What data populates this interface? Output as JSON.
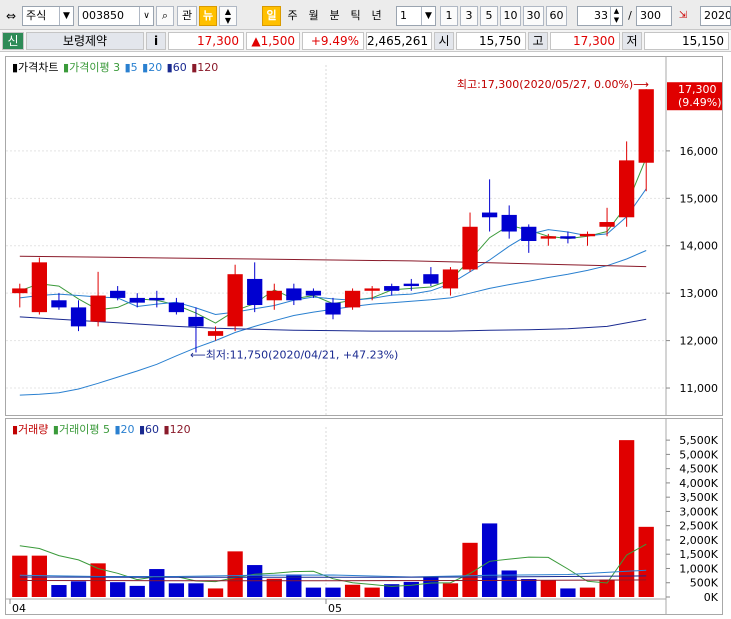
{
  "toolbar": {
    "market_select": "주식",
    "code_input": "003850",
    "btn_gwan": "관",
    "btn_news": "뉴",
    "period_tabs": [
      "일",
      "주",
      "월",
      "분",
      "틱",
      "년"
    ],
    "active_period": "일",
    "interval_value": "1",
    "interval_buttons": [
      "1",
      "3",
      "5",
      "10",
      "30",
      "60"
    ],
    "range_start": "33",
    "range_slash": "/",
    "range_total": "300",
    "date_field": "2020/"
  },
  "quote": {
    "tag": "신",
    "name": "보령제약",
    "info_btn": "i",
    "price": "17,300",
    "change": "▲1,500",
    "change_pct": "+9.49%",
    "volume": "2,465,261",
    "open_label": "시",
    "open": "15,750",
    "high_label": "고",
    "high": "17,300",
    "low_label": "저",
    "low": "15,150"
  },
  "price_panel": {
    "legend": [
      {
        "text": "가격차트",
        "color": "#000000"
      },
      {
        "text": "가격이평 3",
        "color": "#3a9a3a"
      },
      {
        "text": "5",
        "color": "#2a80d0"
      },
      {
        "text": "20",
        "color": "#2a80d0"
      },
      {
        "text": "60",
        "color": "#1a2a90"
      },
      {
        "text": "120",
        "color": "#8a1a2a"
      }
    ],
    "high_annotation": "최고:17,300(2020/05/27, 0.00%)⟶",
    "low_annotation": "⟵최저:11,750(2020/04/21, +47.23%)",
    "last_price_label": "17,300",
    "last_pct_label": "(9.49%)",
    "y_ticks": [
      "16,000",
      "15,000",
      "14,000",
      "13,000",
      "12,000",
      "11,000"
    ],
    "colors": {
      "up": "#e00000",
      "down": "#0000d0"
    }
  },
  "volume_panel": {
    "legend": [
      {
        "text": "거래량",
        "color": "#c00000"
      },
      {
        "text": "거래이평 5",
        "color": "#3a9a3a"
      },
      {
        "text": "20",
        "color": "#2a80d0"
      },
      {
        "text": "60",
        "color": "#1a2a90"
      },
      {
        "text": "120",
        "color": "#8a1a2a"
      }
    ],
    "y_ticks": [
      "5,500K",
      "5,000K",
      "4,500K",
      "4,000K",
      "3,500K",
      "3,000K",
      "2,500K",
      "2,000K",
      "1,500K",
      "1,000K",
      "500K",
      "0K"
    ],
    "x_ticks": [
      "04",
      "05"
    ]
  },
  "chart_data": {
    "type": "candlestick",
    "price_ylim": [
      10600,
      17600
    ],
    "volume_ylim": [
      0,
      5750
    ],
    "candles": [
      {
        "o": 13000,
        "h": 13200,
        "l": 12700,
        "c": 13100
      },
      {
        "o": 12600,
        "h": 13750,
        "l": 12550,
        "c": 13650
      },
      {
        "o": 12850,
        "h": 13000,
        "l": 12650,
        "c": 12700
      },
      {
        "o": 12700,
        "h": 12850,
        "l": 12200,
        "c": 12300
      },
      {
        "o": 12400,
        "h": 13450,
        "l": 12300,
        "c": 12950
      },
      {
        "o": 13050,
        "h": 13150,
        "l": 12850,
        "c": 12900
      },
      {
        "o": 12900,
        "h": 13000,
        "l": 12700,
        "c": 12800
      },
      {
        "o": 12900,
        "h": 13050,
        "l": 12700,
        "c": 12850
      },
      {
        "o": 12800,
        "h": 12900,
        "l": 12550,
        "c": 12600
      },
      {
        "o": 12500,
        "h": 12700,
        "l": 11750,
        "c": 12300
      },
      {
        "o": 12100,
        "h": 12300,
        "l": 12000,
        "c": 12200
      },
      {
        "o": 12300,
        "h": 13600,
        "l": 12200,
        "c": 13400
      },
      {
        "o": 13300,
        "h": 13650,
        "l": 12600,
        "c": 12750
      },
      {
        "o": 12850,
        "h": 13200,
        "l": 12650,
        "c": 13050
      },
      {
        "o": 13100,
        "h": 13200,
        "l": 12750,
        "c": 12850
      },
      {
        "o": 13050,
        "h": 13100,
        "l": 12900,
        "c": 12950
      },
      {
        "o": 12800,
        "h": 12900,
        "l": 12450,
        "c": 12550
      },
      {
        "o": 12700,
        "h": 13100,
        "l": 12650,
        "c": 13050
      },
      {
        "o": 13050,
        "h": 13150,
        "l": 12850,
        "c": 13100
      },
      {
        "o": 13150,
        "h": 13200,
        "l": 12950,
        "c": 13050
      },
      {
        "o": 13200,
        "h": 13300,
        "l": 13050,
        "c": 13150
      },
      {
        "o": 13400,
        "h": 13550,
        "l": 13150,
        "c": 13200
      },
      {
        "o": 13100,
        "h": 13550,
        "l": 12950,
        "c": 13500
      },
      {
        "o": 13500,
        "h": 14700,
        "l": 13450,
        "c": 14400
      },
      {
        "o": 14700,
        "h": 15400,
        "l": 14300,
        "c": 14600
      },
      {
        "o": 14650,
        "h": 14850,
        "l": 14150,
        "c": 14300
      },
      {
        "o": 14400,
        "h": 14450,
        "l": 13850,
        "c": 14100
      },
      {
        "o": 14150,
        "h": 14250,
        "l": 14000,
        "c": 14200
      },
      {
        "o": 14200,
        "h": 14300,
        "l": 14050,
        "c": 14150
      },
      {
        "o": 14200,
        "h": 14300,
        "l": 14000,
        "c": 14250
      },
      {
        "o": 14400,
        "h": 14800,
        "l": 14200,
        "c": 14500
      },
      {
        "o": 14600,
        "h": 16200,
        "l": 14400,
        "c": 15800
      },
      {
        "o": 15750,
        "h": 17300,
        "l": 15150,
        "c": 17300
      }
    ],
    "volumes": [
      1450,
      1450,
      420,
      550,
      1180,
      520,
      390,
      980,
      480,
      480,
      300,
      1600,
      1120,
      640,
      790,
      330,
      330,
      430,
      330,
      450,
      530,
      720,
      480,
      1900,
      2580,
      930,
      630,
      590,
      300,
      330,
      610,
      5500,
      2460
    ],
    "ma": [
      {
        "name": "3",
        "color": "#3a9a3a",
        "points": [
          [
            0,
            13050
          ],
          [
            1,
            13200
          ],
          [
            2,
            13150
          ],
          [
            3,
            12880
          ],
          [
            4,
            12650
          ],
          [
            5,
            12700
          ],
          [
            6,
            12880
          ],
          [
            7,
            12850
          ],
          [
            8,
            12750
          ],
          [
            9,
            12580
          ],
          [
            10,
            12370
          ],
          [
            11,
            12630
          ],
          [
            12,
            12780
          ],
          [
            13,
            13070
          ],
          [
            14,
            12880
          ],
          [
            15,
            12950
          ],
          [
            16,
            12780
          ],
          [
            17,
            12850
          ],
          [
            18,
            12900
          ],
          [
            19,
            13070
          ],
          [
            20,
            13100
          ],
          [
            21,
            13130
          ],
          [
            22,
            13280
          ],
          [
            23,
            13700
          ],
          [
            24,
            14170
          ],
          [
            25,
            14430
          ],
          [
            26,
            14330
          ],
          [
            27,
            14200
          ],
          [
            28,
            14150
          ],
          [
            29,
            14200
          ],
          [
            30,
            14300
          ],
          [
            31,
            14850
          ],
          [
            32,
            15850
          ]
        ]
      },
      {
        "name": "5",
        "color": "#2a80d0",
        "points": [
          [
            0,
            12900
          ],
          [
            1,
            12950
          ],
          [
            2,
            12980
          ],
          [
            3,
            12950
          ],
          [
            4,
            12920
          ],
          [
            5,
            12900
          ],
          [
            6,
            12720
          ],
          [
            7,
            12770
          ],
          [
            8,
            12810
          ],
          [
            9,
            12690
          ],
          [
            10,
            12550
          ],
          [
            11,
            12600
          ],
          [
            12,
            12670
          ],
          [
            13,
            12740
          ],
          [
            14,
            12850
          ],
          [
            15,
            12920
          ],
          [
            16,
            12880
          ],
          [
            17,
            12850
          ],
          [
            18,
            12890
          ],
          [
            19,
            12960
          ],
          [
            20,
            12980
          ],
          [
            21,
            13050
          ],
          [
            22,
            13200
          ],
          [
            23,
            13450
          ],
          [
            24,
            13700
          ],
          [
            25,
            13990
          ],
          [
            26,
            14240
          ],
          [
            27,
            14340
          ],
          [
            28,
            14290
          ],
          [
            29,
            14210
          ],
          [
            30,
            14250
          ],
          [
            31,
            14610
          ],
          [
            32,
            15200
          ]
        ]
      },
      {
        "name": "20",
        "color": "#2a80d0",
        "points": [
          [
            0,
            10850
          ],
          [
            1,
            10870
          ],
          [
            2,
            10900
          ],
          [
            3,
            10980
          ],
          [
            4,
            11100
          ],
          [
            5,
            11230
          ],
          [
            6,
            11360
          ],
          [
            7,
            11500
          ],
          [
            8,
            11680
          ],
          [
            9,
            11850
          ],
          [
            10,
            12000
          ],
          [
            11,
            12170
          ],
          [
            12,
            12300
          ],
          [
            13,
            12420
          ],
          [
            14,
            12530
          ],
          [
            15,
            12600
          ],
          [
            16,
            12660
          ],
          [
            17,
            12720
          ],
          [
            18,
            12770
          ],
          [
            19,
            12800
          ],
          [
            20,
            12830
          ],
          [
            21,
            12860
          ],
          [
            22,
            12900
          ],
          [
            23,
            13000
          ],
          [
            24,
            13100
          ],
          [
            25,
            13180
          ],
          [
            26,
            13250
          ],
          [
            27,
            13330
          ],
          [
            28,
            13400
          ],
          [
            29,
            13480
          ],
          [
            30,
            13580
          ],
          [
            31,
            13720
          ],
          [
            32,
            13900
          ]
        ]
      },
      {
        "name": "60",
        "color": "#1a2a90",
        "points": [
          [
            0,
            12500
          ],
          [
            2,
            12450
          ],
          [
            4,
            12400
          ],
          [
            6,
            12350
          ],
          [
            8,
            12300
          ],
          [
            10,
            12260
          ],
          [
            12,
            12240
          ],
          [
            14,
            12220
          ],
          [
            16,
            12210
          ],
          [
            18,
            12200
          ],
          [
            20,
            12200
          ],
          [
            22,
            12200
          ],
          [
            24,
            12220
          ],
          [
            26,
            12230
          ],
          [
            28,
            12250
          ],
          [
            30,
            12300
          ],
          [
            32,
            12450
          ]
        ]
      },
      {
        "name": "120",
        "color": "#8a1a2a",
        "points": [
          [
            0,
            13780
          ],
          [
            4,
            13760
          ],
          [
            8,
            13740
          ],
          [
            12,
            13720
          ],
          [
            16,
            13700
          ],
          [
            20,
            13680
          ],
          [
            24,
            13640
          ],
          [
            28,
            13600
          ],
          [
            32,
            13560
          ]
        ]
      }
    ],
    "vol_ma": [
      {
        "name": "5",
        "color": "#3a9a3a",
        "points": [
          [
            0,
            1800
          ],
          [
            1,
            1700
          ],
          [
            2,
            1450
          ],
          [
            3,
            1300
          ],
          [
            4,
            1000
          ],
          [
            5,
            830
          ],
          [
            6,
            610
          ],
          [
            7,
            720
          ],
          [
            8,
            720
          ],
          [
            9,
            560
          ],
          [
            10,
            540
          ],
          [
            11,
            680
          ],
          [
            12,
            800
          ],
          [
            13,
            830
          ],
          [
            14,
            890
          ],
          [
            15,
            900
          ],
          [
            16,
            640
          ],
          [
            17,
            500
          ],
          [
            18,
            440
          ],
          [
            19,
            370
          ],
          [
            20,
            410
          ],
          [
            21,
            490
          ],
          [
            22,
            500
          ],
          [
            23,
            820
          ],
          [
            24,
            1250
          ],
          [
            25,
            1330
          ],
          [
            26,
            1400
          ],
          [
            27,
            1390
          ],
          [
            28,
            980
          ],
          [
            29,
            550
          ],
          [
            30,
            490
          ],
          [
            31,
            1470
          ],
          [
            32,
            1850
          ]
        ]
      },
      {
        "name": "20",
        "color": "#2a80d0",
        "points": [
          [
            0,
            760
          ],
          [
            4,
            720
          ],
          [
            8,
            720
          ],
          [
            12,
            760
          ],
          [
            16,
            770
          ],
          [
            20,
            700
          ],
          [
            24,
            760
          ],
          [
            28,
            790
          ],
          [
            32,
            940
          ]
        ]
      },
      {
        "name": "60",
        "color": "#1a2a90",
        "points": [
          [
            0,
            700
          ],
          [
            8,
            690
          ],
          [
            16,
            690
          ],
          [
            24,
            700
          ],
          [
            32,
            740
          ]
        ]
      },
      {
        "name": "120",
        "color": "#8a1a2a",
        "points": [
          [
            0,
            580
          ],
          [
            8,
            570
          ],
          [
            16,
            570
          ],
          [
            24,
            580
          ],
          [
            32,
            600
          ]
        ]
      }
    ]
  }
}
